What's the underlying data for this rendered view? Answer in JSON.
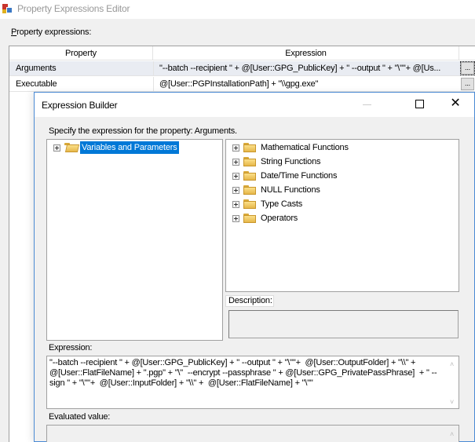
{
  "outer_window": {
    "title": "Property Expressions Editor",
    "property_expressions_label_accel": "P",
    "property_expressions_label_rest": "roperty expressions:",
    "grid": {
      "columns": [
        "Property",
        "Expression"
      ],
      "rows": [
        {
          "property": "Arguments",
          "expression": "\"--batch --recipient \" + @[User::GPG_PublicKey] + \" --output \" + \"\\\"\"+  @[Us...",
          "button": "...",
          "selected": true
        },
        {
          "property": "Executable",
          "expression": "@[User::PGPInstallationPath] + \"\\\\gpg.exe\"",
          "button": "...",
          "selected": false
        }
      ]
    }
  },
  "dialog": {
    "title": "Expression Builder",
    "controls": {
      "minimize": "—",
      "maximize": "□",
      "close": "✕"
    },
    "instruction": "Specify the expression for the property: Arguments.",
    "left_tree": {
      "items": [
        {
          "label": "Variables and Parameters",
          "icon": "folder-open-icon",
          "selected": true
        }
      ]
    },
    "right_tree": {
      "items": [
        {
          "label": "Mathematical Functions",
          "icon": "folder-icon"
        },
        {
          "label": "String Functions",
          "icon": "folder-icon"
        },
        {
          "label": "Date/Time Functions",
          "icon": "folder-icon"
        },
        {
          "label": "NULL Functions",
          "icon": "folder-icon"
        },
        {
          "label": "Type Casts",
          "icon": "folder-icon"
        },
        {
          "label": "Operators",
          "icon": "folder-icon"
        }
      ]
    },
    "description_label": "Description:",
    "description_value": "",
    "expression_label": "Expression:",
    "expression_value": "\"--batch --recipient \" + @[User::GPG_PublicKey] + \" --output \" + \"\\\"\"+  @[User::OutputFolder] + \"\\\\\" + @[User::FlatFileName] + \".pgp\" + \"\\\"  --encrypt --passphrase \" + @[User::GPG_PrivatePassPhrase]  + \" --sign \" + \"\\\"\"+  @[User::InputFolder] + \"\\\\\" +  @[User::FlatFileName] + \"\\\"\"",
    "evaluated_label": "Evaluated value:",
    "evaluated_value": "",
    "scroll_up": "˄",
    "scroll_down": "˅"
  }
}
